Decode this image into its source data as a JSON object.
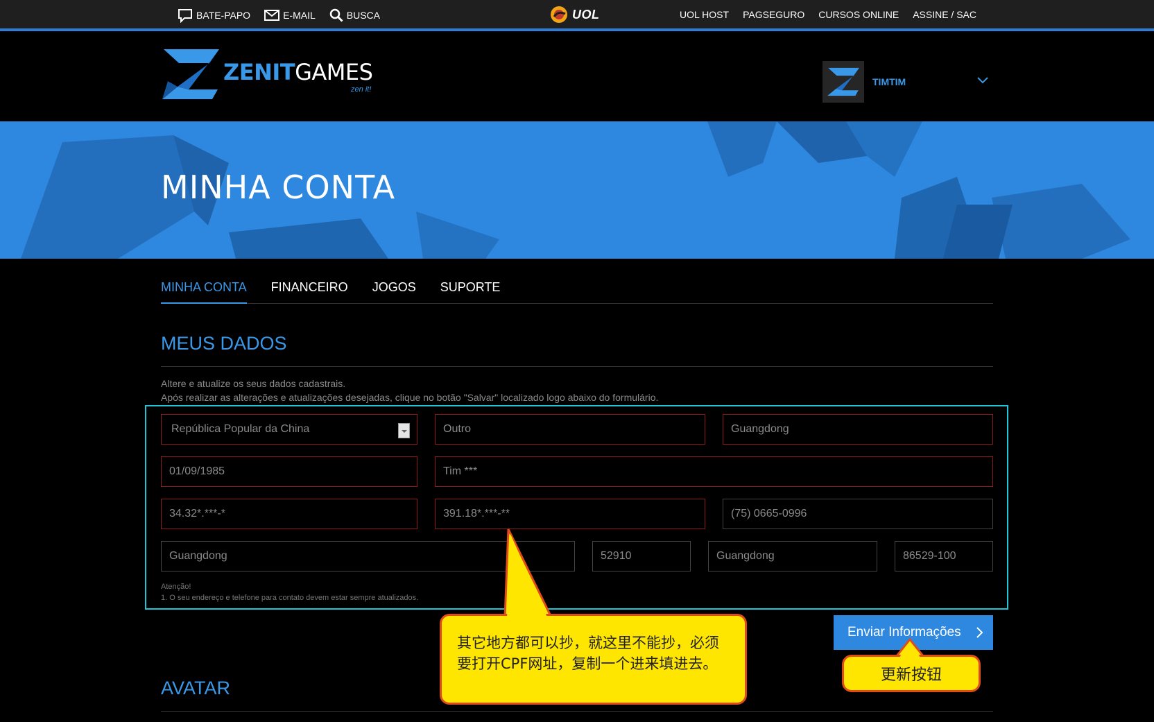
{
  "uol_bar": {
    "left_links": [
      {
        "label": "BATE-PAPO",
        "icon": "chat-icon"
      },
      {
        "label": "E-MAIL",
        "icon": "mail-icon"
      },
      {
        "label": "BUSCA",
        "icon": "search-icon"
      }
    ],
    "logo_text": "UOL",
    "right_links": [
      "UOL HOST",
      "PAGSEGURO",
      "CURSOS ONLINE",
      "ASSINE / SAC"
    ],
    "accent_color": "#2e7ed6"
  },
  "header": {
    "brand_zenit": "ZENIT",
    "brand_games": "GAMES",
    "brand_tagline": "zen it!",
    "username": "TIMTIM"
  },
  "hero": {
    "title": "MINHA CONTA",
    "background_color": "#2e88e0"
  },
  "tabs": [
    {
      "label": "MINHA CONTA",
      "active": true
    },
    {
      "label": "FINANCEIRO",
      "active": false
    },
    {
      "label": "JOGOS",
      "active": false
    },
    {
      "label": "SUPORTE",
      "active": false
    }
  ],
  "meus_dados": {
    "title": "MEUS DADOS",
    "intro_line1": "Altere e atualize os seus dados cadastrais.",
    "intro_line2": "Após realizar as alterações e atualizações desejadas, clique no botão \"Salvar\" localizado logo abaixo do formulário.",
    "fields": {
      "country": "República Popular da China",
      "city_type": "Outro",
      "state": "Guangdong",
      "birth_date": "01/09/1985",
      "full_name": "Tim ***",
      "rg": "34.32*.***-*",
      "cpf": "391.18*.***-**",
      "phone": "(75) 0665-0996",
      "address": "Guangdong",
      "number": "52910",
      "district": "Guangdong",
      "zip": "86529-100"
    },
    "notice_title": "Atenção!",
    "notice_text": "1. O seu endereço e telefone para contato devem estar sempre atualizados.",
    "submit_label": "Enviar Informações"
  },
  "avatar_section": {
    "title": "AVATAR"
  },
  "annotations": {
    "cpf_note": "其它地方都可以抄，就这里不能抄，必须要打开CPF网址，复制一个进来填进去。",
    "button_note": "更新按钮",
    "box_color": "#22c3d6",
    "callout_fill": "#ffe600",
    "callout_border": "#e04b1b"
  }
}
